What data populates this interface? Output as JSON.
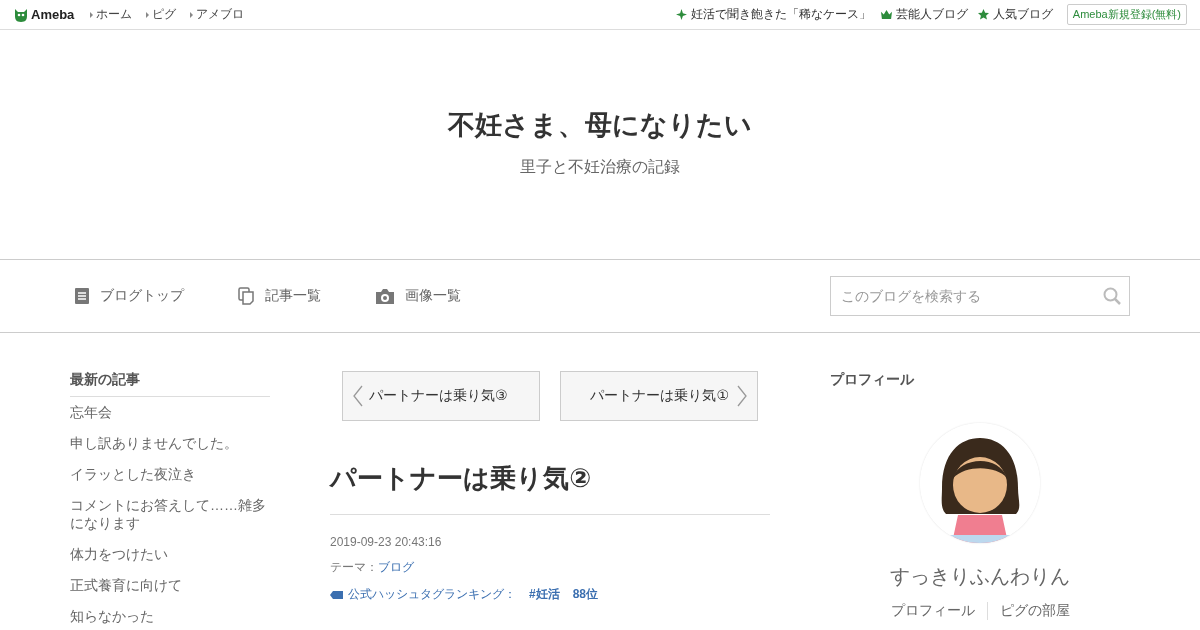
{
  "topbar": {
    "logo": "Ameba",
    "nav_links": [
      "ホーム",
      "ピグ",
      "アメブロ"
    ],
    "right_links": [
      {
        "kind": "sparkle",
        "label": "妊活で聞き飽きた「稀なケース」"
      },
      {
        "kind": "crown",
        "label": "芸能人ブログ"
      },
      {
        "kind": "star",
        "label": "人気ブログ"
      }
    ],
    "register_button": "Ameba新規登録(無料)"
  },
  "header": {
    "title": "不妊さま、母になりたい",
    "subtitle": "里子と不妊治療の記録"
  },
  "blog_nav": {
    "items": [
      {
        "kind": "document",
        "label": "ブログトップ"
      },
      {
        "kind": "copy",
        "label": "記事一覧"
      },
      {
        "kind": "camera",
        "label": "画像一覧"
      }
    ],
    "search": {
      "placeholder": "このブログを検索する"
    }
  },
  "sidebar": {
    "heading": "最新の記事",
    "items": [
      "忘年会",
      "申し訳ありませんでした。",
      "イラッとした夜泣き",
      "コメントにお答えして……雑多になります",
      "体力をつけたい",
      "正式養育に向けて",
      "知らなかった"
    ]
  },
  "article": {
    "prev_link": "パートナーは乗り気③",
    "next_link": "パートナーは乗り気①",
    "title": "パートナーは乗り気②",
    "date": "2019-09-23 20:43:16",
    "theme_label": "テーマ：",
    "theme": "ブログ",
    "ranking_label": "公式ハッシュタグランキング：",
    "ranking_tag": "#妊活",
    "ranking_rank": "88位"
  },
  "profile": {
    "heading": "プロフィール",
    "name": "すっきりふんわりん",
    "links": [
      "プロフィール",
      "ピグの部屋"
    ]
  }
}
